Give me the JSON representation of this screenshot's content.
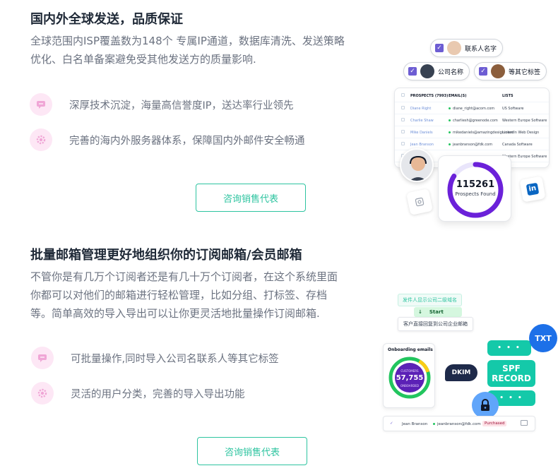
{
  "section1": {
    "title": "国内外全球发送，品质保证",
    "desc_line1": "全球范围内ISP覆盖数为148个 专属IP通道，数据库清洗、发送策略",
    "desc_line2": "优化、白名单备案避免受其他发送方的质量影响.",
    "features": [
      {
        "icon": "message-icon",
        "text": "深厚技术沉淀，海量高信誉度IP，送达率行业领先"
      },
      {
        "icon": "gear-icon",
        "text": "完善的海内外服务器体系，保障国内外邮件安全畅通"
      }
    ],
    "cta": "咨询销售代表",
    "illustration": {
      "chips": [
        {
          "label": "联系人名字"
        },
        {
          "label": "公司名称"
        },
        {
          "label": "等其它标签"
        }
      ],
      "table": {
        "headers": [
          "PROSPECTS (7993)",
          "EMAIL(S)",
          "LISTS"
        ],
        "rows": [
          {
            "name": "Diane Right",
            "email": "diane_right@acom.com",
            "list": "US Software"
          },
          {
            "name": "Charlie Shaw",
            "email": "charliesh@greenode.com",
            "list": "Western Europe Software"
          },
          {
            "name": "Mike Daniels",
            "email": "mikedaniels@amazingdesign.com",
            "list": "LinkedIn Web Design"
          },
          {
            "name": "Jean Branson",
            "email": "jeanbranson@fdk.com",
            "list": "Canada Software"
          },
          {
            "name": "",
            "email": "",
            "list": "Western Europe Software"
          }
        ]
      },
      "gauge_value": "115261",
      "gauge_label": "Prospects Found",
      "linkedin": "in"
    }
  },
  "section2": {
    "title": "批量邮箱管理更好地组织你的订阅邮箱/会员邮箱",
    "desc_line1": "不管你是有几万个订阅者还是有几十万个订阅者，在这个系统里面",
    "desc_line2": "你都可以对他们的邮箱进行轻松管理，比如分组、打标签、存档",
    "desc_line3": "等。简单高效的导入导出可以让你更灵活地批量操作订阅邮箱.",
    "features": [
      {
        "icon": "message-icon",
        "text": "可批量操作,同时导入公司名联系人等其它标签"
      },
      {
        "icon": "gear-icon",
        "text": "灵活的用户分类，完善的导入导出功能"
      }
    ],
    "cta": "咨询销售代表",
    "illustration": {
      "sender_pill": "发件人显示公司二级域名",
      "start_pill": "Start",
      "reply_pill": "客户直接回复到公司企业邮箱",
      "onboarding_title": "Onboarding emails",
      "ring_label_top": "CUSTOMERS",
      "ring_value": "57,755",
      "ring_label_bottom": "ONBOARDED",
      "dkim": "DKIM",
      "txt": "TXT",
      "spf_line1": "SPF",
      "spf_line2": "RECORD",
      "dots": "• • •",
      "row_name": "Jean Branson",
      "row_email": "jeanbranson@fdk.com",
      "row_status": "Purchased"
    }
  },
  "colors": {
    "accent": "#2ec4a0",
    "purple": "#6d5dd3",
    "pink_bg": "#fde7f5",
    "teal": "#14c9a9",
    "blue": "#1d70e8"
  }
}
